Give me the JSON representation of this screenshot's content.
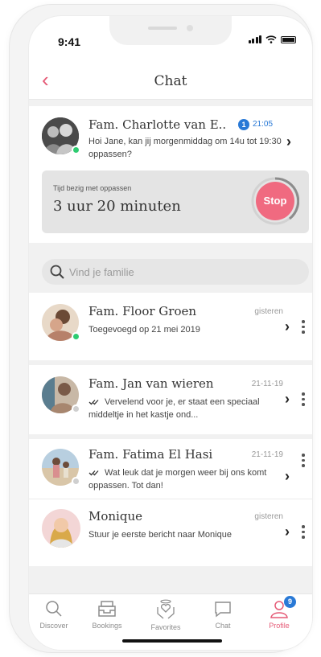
{
  "status_bar": {
    "time": "9:41"
  },
  "header": {
    "title": "Chat",
    "back_icon": "chevron-left-icon"
  },
  "active_chat": {
    "name": "Fam. Charlotte van E..",
    "unread": "1",
    "time": "21:05",
    "message": "Hoi Jane, kan jij morgenmiddag om 14u tot 19:30 oppassen?",
    "online": true
  },
  "timer": {
    "label": "Tijd bezig met oppassen",
    "value": "3 uur 20 minuten",
    "stop_label": "Stop"
  },
  "search": {
    "placeholder": "Vind je familie"
  },
  "chats": [
    {
      "name": "Fam. Floor Groen",
      "time": "gisteren",
      "message": "Toegevoegd op 21 mei 2019",
      "online": true
    },
    {
      "name": "Fam. Jan van wieren",
      "time": "21-11-19",
      "message": "Vervelend voor je, er staat een speciaal middeltje in het kastje ond...",
      "read": true,
      "online": false
    },
    {
      "name": "Fam. Fatima El Hasi",
      "time": "21-11-19",
      "message": "Wat leuk dat je morgen weer bij ons komt oppassen. Tot dan!",
      "read": true,
      "online": false
    },
    {
      "name": "Monique",
      "time": "gisteren",
      "message": "Stuur je eerste bericht naar Monique"
    }
  ],
  "tabs": [
    {
      "label": "Discover",
      "icon": "search-icon"
    },
    {
      "label": "Bookings",
      "icon": "inbox-tray-icon"
    },
    {
      "label": "Favorites",
      "icon": "heart-hands-icon"
    },
    {
      "label": "Chat",
      "icon": "speech-bubble-icon"
    },
    {
      "label": "Profile",
      "icon": "user-icon",
      "badge": "9",
      "active": true
    }
  ],
  "colors": {
    "accent": "#e55a76",
    "stop": "#f06a80",
    "blue": "#2979d6",
    "online": "#2ecc71"
  }
}
